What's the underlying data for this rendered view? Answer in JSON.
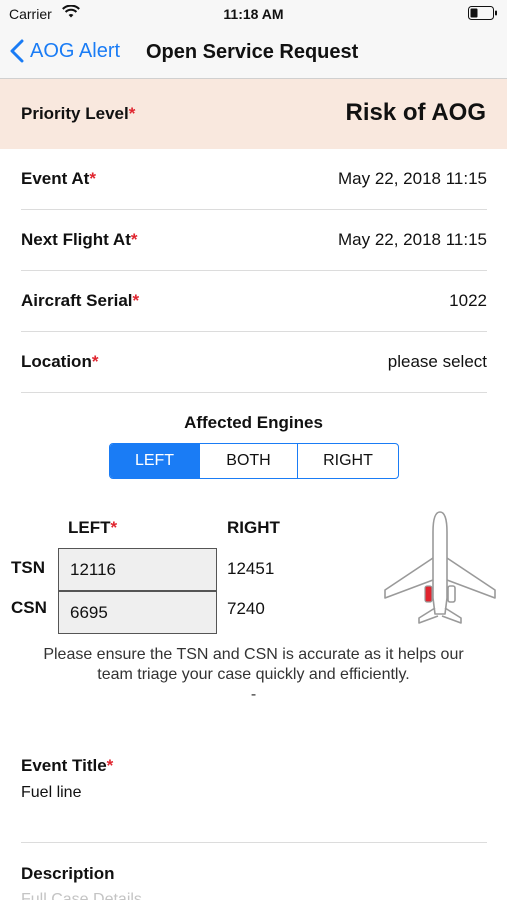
{
  "status_bar": {
    "carrier": "Carrier",
    "time": "11:18 AM"
  },
  "nav": {
    "back_label": "AOG Alert",
    "title": "Open Service Request"
  },
  "priority": {
    "label": "Priority Level",
    "required": "*",
    "value": "Risk of AOG"
  },
  "rows": [
    {
      "label": "Event At",
      "required": "*",
      "value": "May 22, 2018 11:15"
    },
    {
      "label": "Next Flight At",
      "required": "*",
      "value": "May 22, 2018 11:15"
    },
    {
      "label": "Aircraft Serial",
      "required": "*",
      "value": "1022"
    },
    {
      "label": "Location",
      "required": "*",
      "value": "please select"
    }
  ],
  "engines": {
    "title": "Affected Engines",
    "options": [
      "LEFT",
      "BOTH",
      "RIGHT"
    ],
    "selected": "LEFT",
    "col_left": "LEFT",
    "col_left_required": "*",
    "col_right": "RIGHT",
    "tsn_label": "TSN",
    "csn_label": "CSN",
    "tsn_left": "12116",
    "csn_left": "6695",
    "tsn_right": "12451",
    "csn_right": "7240",
    "note": "Please ensure the TSN and CSN is accurate as it helps our team triage your case quickly and efficiently.",
    "note_dash": "-"
  },
  "event_title": {
    "label": "Event Title",
    "required": "*",
    "value": "Fuel line"
  },
  "description": {
    "label": "Description",
    "placeholder": "Full Case Details"
  },
  "colors": {
    "accent": "#1a7cf5",
    "required": "#e0242e",
    "priority_bg": "#f9e8de",
    "engine_highlight": "#e0242e"
  }
}
